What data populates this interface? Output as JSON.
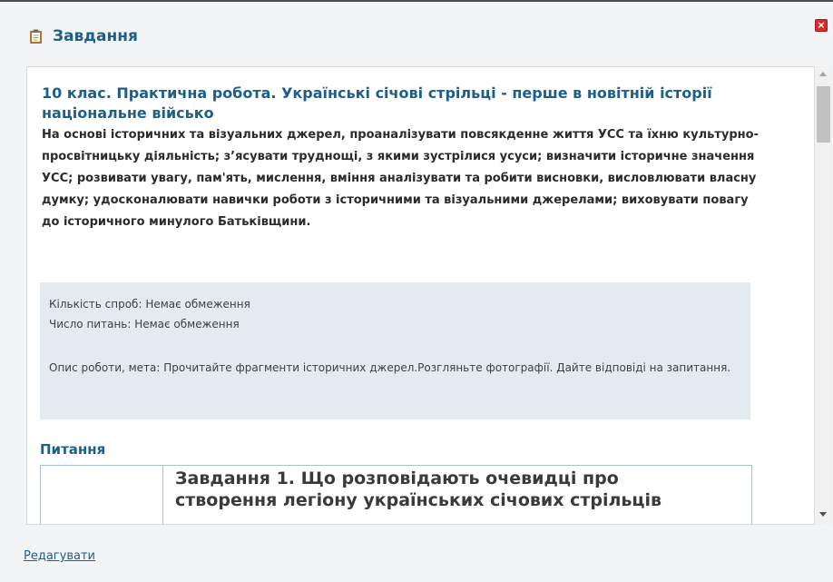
{
  "dialog": {
    "title": "Завдання",
    "icon": "clipboard-icon",
    "close_icon": "close-icon",
    "close_symbol": "×",
    "close_color": "#d02d2d",
    "accent_color": "#1b5f8c"
  },
  "lesson": {
    "title": "10 клас. Практична робота. Українські січові стрільці - перше в новітній історії національне військо",
    "description": "На основі історичних та візуальних джерел, проаналізувати повсякденне життя УСС та їхню культурно-просвітницьку діяльність; з’ясувати труднощі, з якими зустрілися усуси; визначити історичне значення УСС; розвивати увагу, пам'ять, мислення, вміння аналізувати та робити висновки, висловлювати власну думку; удосконалювати навички роботи з історичними та візуальними джерелами; виховувати повагу до історичного минулого Батьківщини."
  },
  "info": {
    "attempts": "Кількість спроб: Немає обмеження",
    "questions": "Число питань: Немає обмеження",
    "description": "Опис роботи, мета: Прочитайте фрагменти історичних джерел.Розгляньте фотографії. Дайте відповіді на запитання."
  },
  "questions_section": {
    "heading": "Питання",
    "first_question": "Завдання 1. Що розповідають очевидці про створення легіону українських січових стрільців"
  },
  "footer": {
    "edit_label": "Редагувати"
  }
}
